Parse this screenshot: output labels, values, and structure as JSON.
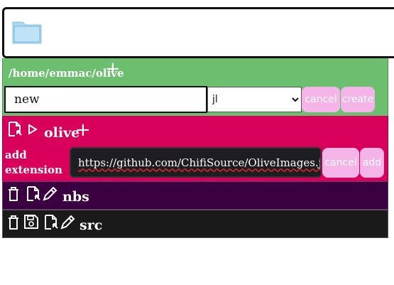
{
  "top": {
    "icon": "folder-icon"
  },
  "path_row": {
    "path": "/home/emmac/olive",
    "plus": "+",
    "name_value": "new",
    "extension_selected": "jl",
    "cancel_label": "cancel",
    "create_label": "create"
  },
  "olive_row": {
    "title": "olive",
    "plus": "+",
    "add_label": "add extension",
    "url_value": "https://github.com/ChifiSource/OliveImages.jl",
    "cancel_label": "cancel",
    "add_btn_label": "add"
  },
  "nbs_row": {
    "title": "nbs"
  },
  "src_row": {
    "title": "src"
  },
  "colors": {
    "path_bg": "#6bbf6e",
    "olive_bg": "#d9005c",
    "nbs_bg": "#3a0040",
    "src_bg": "#1a1a1a",
    "button_pink": "#f5b4e7",
    "folder": "#a9d6f0"
  }
}
